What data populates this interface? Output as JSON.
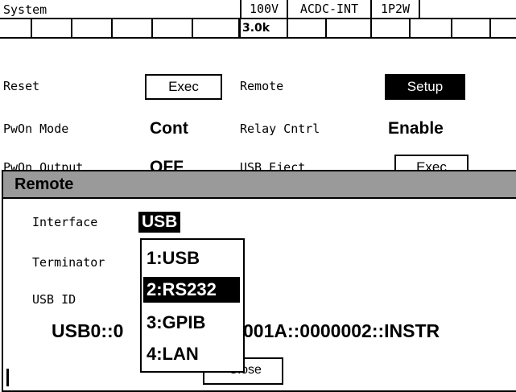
{
  "status_bar": {
    "mode": "System",
    "voltage_range": "100V",
    "output_mode": "ACDC-INT",
    "phase": "1P2W"
  },
  "softkeys": {
    "frequency": "3.0k"
  },
  "settings": {
    "reset_label": "Reset",
    "reset_button": "Exec",
    "remote_label": "Remote",
    "remote_button": "Setup",
    "pwon_mode_label": "PwOn Mode",
    "pwon_mode_value": "Cont",
    "relay_label": "Relay Cntrl",
    "relay_value": "Enable",
    "pwon_output_label": "PwOn Output",
    "pwon_output_value": "OFF",
    "usb_eject_label": "USB Eject",
    "usb_eject_button": "Exec"
  },
  "dialog": {
    "title": "Remote",
    "interface_label": "Interface",
    "interface_value": "USB",
    "terminator_label": "Terminator",
    "usb_id_label": "USB ID",
    "usb_id_prefix": "USB0::0",
    "usb_id_suffix": "001A::0000002::INSTR",
    "close_label": "Close"
  },
  "dropdown": {
    "options": [
      "1:USB",
      "2:RS232",
      "3:GPIB",
      "4:LAN"
    ],
    "highlighted": "2:RS232"
  }
}
